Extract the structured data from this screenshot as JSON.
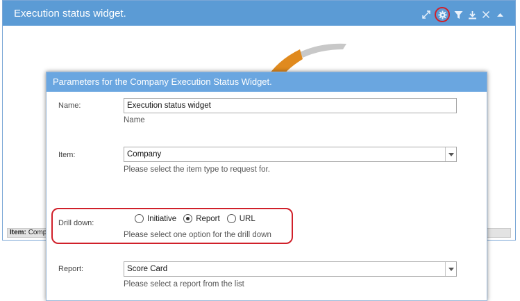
{
  "widget": {
    "title": "Execution status widget.",
    "footer_label": "Item:",
    "footer_value": "Comp",
    "colors": {
      "header": "#5b9bd5",
      "gauge_primary": "#e08a1e",
      "gauge_secondary": "#c8c8c8"
    },
    "tools": [
      "expand-icon",
      "gear-icon",
      "filter-icon",
      "download-icon",
      "close-icon",
      "collapse-up-icon"
    ]
  },
  "dialog": {
    "title": "Parameters for the Company Execution Status Widget.",
    "name": {
      "label": "Name:",
      "value": "Execution status widget",
      "hint": "Name"
    },
    "item": {
      "label": "Item:",
      "value": "Company",
      "hint": "Please select the item type to request for."
    },
    "drill_down": {
      "label": "Drill down:",
      "options": [
        "Initiative",
        "Report",
        "URL"
      ],
      "selected": "Report",
      "hint": "Please select one option for the drill down"
    },
    "report": {
      "label": "Report:",
      "value": "Score Card",
      "hint": "Please select a report from the list"
    }
  }
}
